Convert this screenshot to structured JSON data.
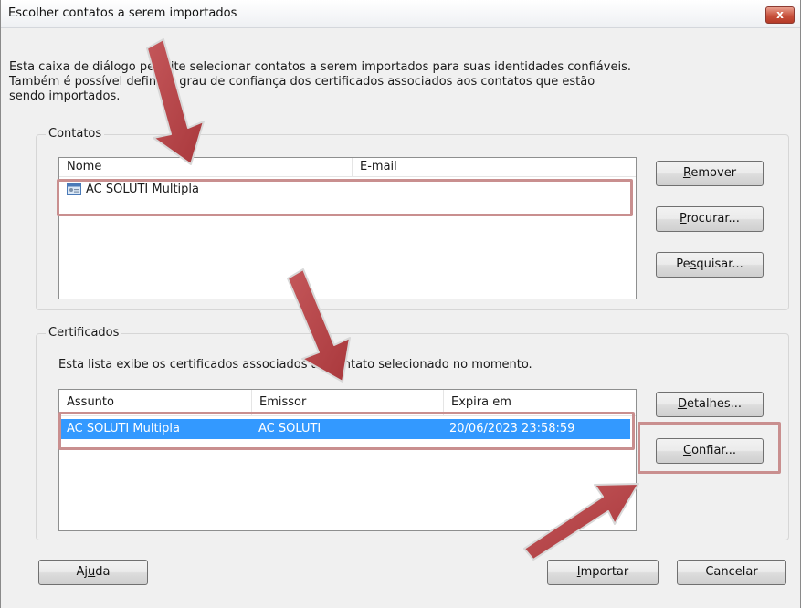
{
  "window": {
    "title": "Escolher contatos a serem importados",
    "close_label": "x"
  },
  "description": {
    "line1": "Esta caixa de diálogo permite selecionar contatos a serem importados para suas identidades confiáveis.",
    "line2": "Também é possível definir o grau de confiança dos certificados associados aos contatos que estão",
    "line3": "sendo importados."
  },
  "contatos": {
    "legend": "Contatos",
    "columns": [
      "Nome",
      "E-mail"
    ],
    "rows": [
      {
        "name": "AC SOLUTI Multipla",
        "email": "",
        "icon": "contact-card-icon"
      }
    ],
    "buttons": {
      "remove": {
        "pre": "",
        "mn": "R",
        "post": "emover"
      },
      "browse": {
        "pre": "",
        "mn": "P",
        "post": "rocurar..."
      },
      "search": {
        "pre": "Pe",
        "mn": "s",
        "post": "quisar..."
      }
    }
  },
  "certificados": {
    "legend": "Certificados",
    "info": "Esta lista exibe os certificados associados ao contato selecionado no momento.",
    "columns": [
      "Assunto",
      "Emissor",
      "Expira em"
    ],
    "rows": [
      {
        "subject": "AC SOLUTI Multipla",
        "issuer": "AC SOLUTI",
        "expires": "20/06/2023 23:58:59",
        "selected": true
      }
    ],
    "buttons": {
      "details": {
        "pre": "",
        "mn": "D",
        "post": "etalhes..."
      },
      "trust": {
        "pre": "",
        "mn": "C",
        "post": "onfiar..."
      }
    }
  },
  "footer": {
    "help": {
      "pre": "Aj",
      "mn": "u",
      "post": "da"
    },
    "import": {
      "pre": "",
      "mn": "I",
      "post": "mportar"
    },
    "cancel": {
      "pre": "Cancelar",
      "mn": "",
      "post": ""
    }
  },
  "colors": {
    "selection": "#3399ff",
    "highlight_box": "#c98f8f",
    "arrow": "#b8464a",
    "close_button": "#c7503c"
  }
}
